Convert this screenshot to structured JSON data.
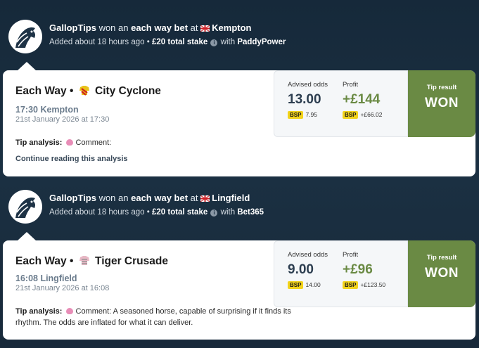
{
  "feed": [
    {
      "header": {
        "user": "GallopTips",
        "won_text": "won an",
        "bet_kind": "each way bet",
        "at_text": "at",
        "course": "Kempton",
        "added": "Added about 18 hours ago •",
        "stake": "£20 total stake",
        "with_text": "with",
        "bookmaker": "PaddyPower"
      },
      "card": {
        "bet_type": "Each Way •",
        "horse": "City Cyclone",
        "race": "17:30 Kempton",
        "date": "21st January 2026 at 17:30",
        "analysis_label": "Tip analysis:",
        "comment": "Comment:",
        "continue_label": "Continue reading this analysis",
        "advised_label": "Advised odds",
        "advised_value": "13.00",
        "bsp_label": "BSP",
        "bsp_value": "7.95",
        "profit_label": "Profit",
        "profit_value": "+£144",
        "bsp_profit": "+£66.02",
        "result_label": "Tip result",
        "result_value": "WON",
        "result_color": "#6a8a44",
        "silk_icon": "silk-red-yellow-icon"
      }
    },
    {
      "header": {
        "user": "GallopTips",
        "won_text": "won an",
        "bet_kind": "each way bet",
        "at_text": "at",
        "course": "Lingfield",
        "added": "Added about 18 hours ago •",
        "stake": "£20 total stake",
        "with_text": "with",
        "bookmaker": "Bet365"
      },
      "card": {
        "bet_type": "Each Way •",
        "horse": "Tiger Crusade",
        "race": "16:08 Lingfield",
        "date": "21st January 2026 at 16:08",
        "analysis_label": "Tip analysis:",
        "comment": "Comment: A seasoned horse, capable of surprising if it finds its rhythm. The odds are inflated for what it can deliver.",
        "advised_label": "Advised odds",
        "advised_value": "9.00",
        "bsp_label": "BSP",
        "bsp_value": "14.00",
        "profit_label": "Profit",
        "profit_value": "+£96",
        "bsp_profit": "+£123.50",
        "result_label": "Tip result",
        "result_value": "WON",
        "result_color": "#6a8a44",
        "silk_icon": "silk-pink-grey-icon"
      }
    }
  ]
}
